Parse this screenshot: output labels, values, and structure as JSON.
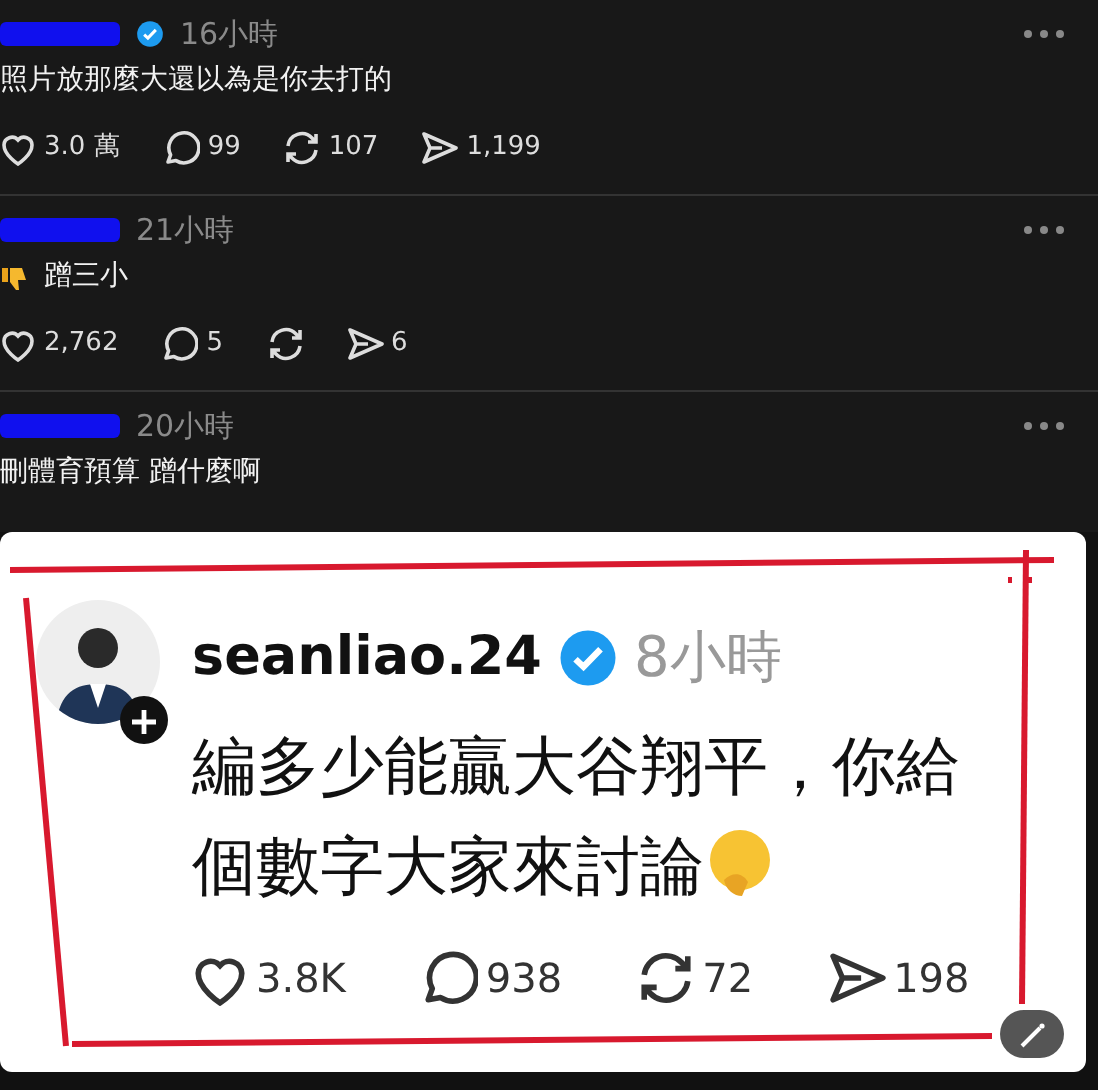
{
  "comments": [
    {
      "verified": true,
      "time": "16小時",
      "text": "照片放那麼大還以為是你去打的",
      "lead_icon": false,
      "stats": [
        {
          "kind": "like",
          "count": "3.0 萬"
        },
        {
          "kind": "reply",
          "count": "99"
        },
        {
          "kind": "repost",
          "count": "107"
        },
        {
          "kind": "share",
          "count": "1,199"
        }
      ]
    },
    {
      "verified": false,
      "time": "21小時",
      "text": "蹭三小",
      "lead_icon": true,
      "stats": [
        {
          "kind": "like",
          "count": "2,762"
        },
        {
          "kind": "reply",
          "count": "5"
        },
        {
          "kind": "repost"
        },
        {
          "kind": "share",
          "count": "6"
        }
      ]
    },
    {
      "verified": false,
      "time": "20小時",
      "text": "刪體育預算 蹭什麼啊",
      "lead_icon": false
    }
  ],
  "post": {
    "username": "seanliao.24",
    "verified": true,
    "time": "8小時",
    "text": "編多少能贏大谷翔平，你給個數字大家來討論",
    "trailing_emoji": true,
    "stats": [
      {
        "kind": "like",
        "count": "3.8K"
      },
      {
        "kind": "reply",
        "count": "938"
      },
      {
        "kind": "repost",
        "count": "72"
      },
      {
        "kind": "share",
        "count": "198"
      }
    ]
  }
}
